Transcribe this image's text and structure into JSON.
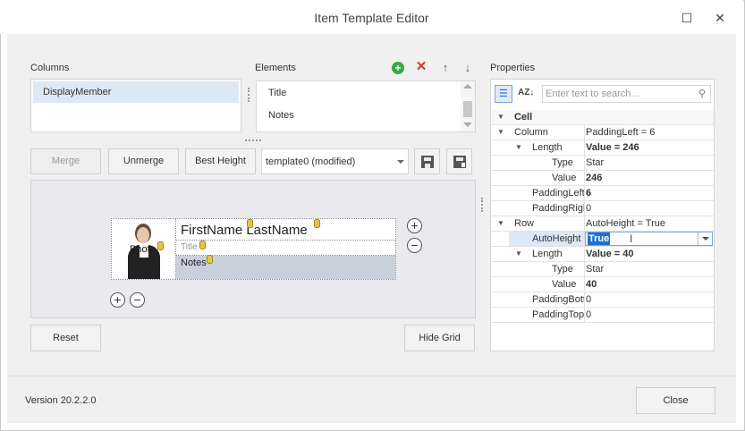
{
  "window": {
    "title": "Item Template Editor",
    "maximize_glyph": "☐",
    "close_glyph": "✕"
  },
  "columns": {
    "label": "Columns",
    "items": [
      "DisplayMember"
    ]
  },
  "elements": {
    "label": "Elements",
    "items": [
      "Title",
      "Notes"
    ]
  },
  "properties_label": "Properties",
  "toolbar": {
    "merge": "Merge",
    "unmerge": "Unmerge",
    "best_height": "Best Height",
    "template_value": "template0 (modified)"
  },
  "preview": {
    "name_text": "FirstName LastName",
    "title_text": "Title",
    "notes_text": "Notes",
    "photo_text": "Photo",
    "plus": "+",
    "minus": "−"
  },
  "buttons": {
    "reset": "Reset",
    "hide_grid": "Hide Grid",
    "close": "Close"
  },
  "version": "Version 20.2.2.0",
  "search_placeholder": "Enter text to search...",
  "property_grid": {
    "rows": [
      {
        "name": "Cell",
        "value": "",
        "expander": "▼",
        "bold_name": true
      },
      {
        "name": "Column",
        "value": "PaddingLeft = 6",
        "expander": "▼"
      },
      {
        "name": "Length",
        "value": "Value = 246",
        "expander": "▼",
        "bold_value": true
      },
      {
        "name": "Type",
        "value": "Star"
      },
      {
        "name": "Value",
        "value": "246",
        "bold_value": true
      },
      {
        "name": "PaddingLeft",
        "value": "6",
        "bold_value": true
      },
      {
        "name": "PaddingRigh",
        "value": "0"
      },
      {
        "name": "Row",
        "value": "AutoHeight = True",
        "expander": "▼"
      },
      {
        "name": "AutoHeight",
        "value": "True",
        "selected": true
      },
      {
        "name": "Length",
        "value": "Value = 40",
        "expander": "▼",
        "bold_value": true
      },
      {
        "name": "Type",
        "value": "Star"
      },
      {
        "name": "Value",
        "value": "40",
        "bold_value": true
      },
      {
        "name": "PaddingBotto",
        "value": "0"
      },
      {
        "name": "PaddingTop",
        "value": "0"
      }
    ]
  },
  "colors": {
    "accent": "#1e6fd0",
    "add_green": "#3aa843",
    "delete_red": "#d23b2c",
    "selected_row": "#dde8f5"
  }
}
